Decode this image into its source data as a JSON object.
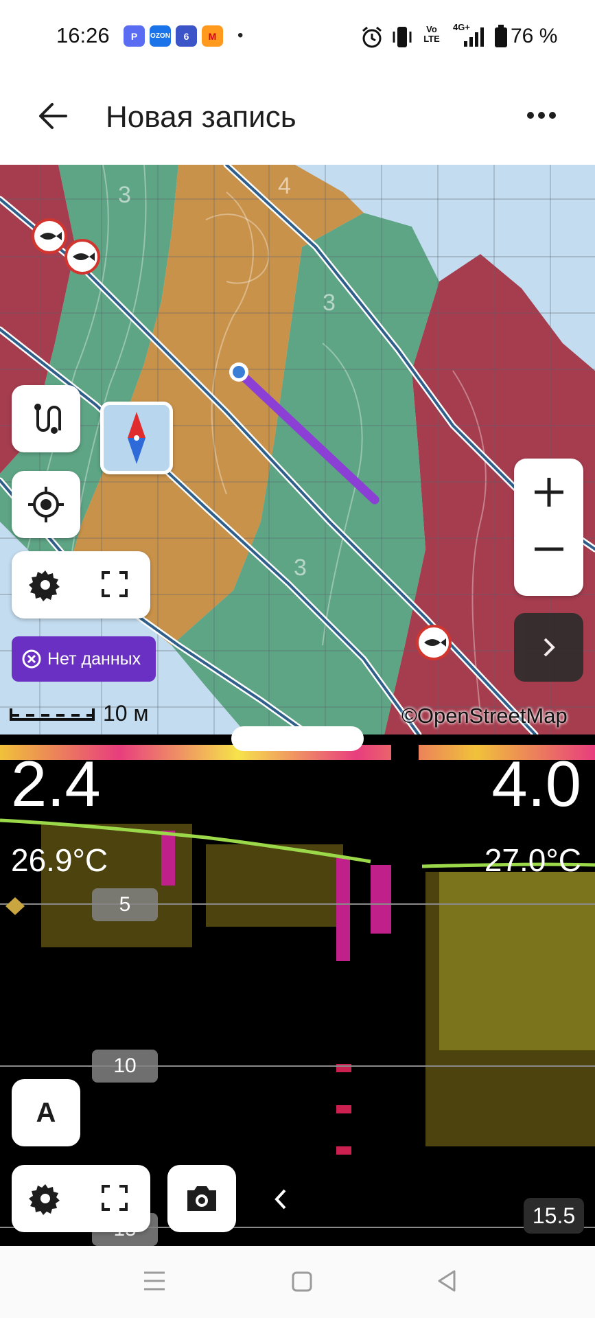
{
  "status_bar": {
    "time": "16:26",
    "apps": [
      {
        "icon": "app-p-icon",
        "color": "#5a6cf2",
        "text": "P"
      },
      {
        "icon": "ozon-icon",
        "color": "#1a73e8",
        "text": "OZON"
      },
      {
        "icon": "app-6-icon",
        "color": "#3b55c8",
        "text": "6"
      },
      {
        "icon": "yandex-market-icon",
        "color": "#ff9a1e",
        "text": "M"
      }
    ],
    "battery": "76 %",
    "network": "4G+",
    "volte": "Vo LTE"
  },
  "app_bar": {
    "title": "Новая запись"
  },
  "map": {
    "zone_labels": [
      "3",
      "4",
      "3",
      "3"
    ],
    "no_data_label": "Нет данных",
    "scale_label": "10 м",
    "attribution": "©OpenStreetMap",
    "colors": {
      "water": "#c4dcef",
      "red_zone": "#a63d4f",
      "green_zone": "#5ea585",
      "orange_zone": "#c9924a",
      "track": "#8c3fd4",
      "position": "#3a7fd5"
    }
  },
  "sonar": {
    "depth_left": "2.4",
    "depth_right": "4.0",
    "temp_left": "26.9°C",
    "temp_right": "27.0°C",
    "depth_marks": [
      "5",
      "10",
      "15"
    ],
    "mode_button": "A",
    "range_value": "15.5"
  }
}
